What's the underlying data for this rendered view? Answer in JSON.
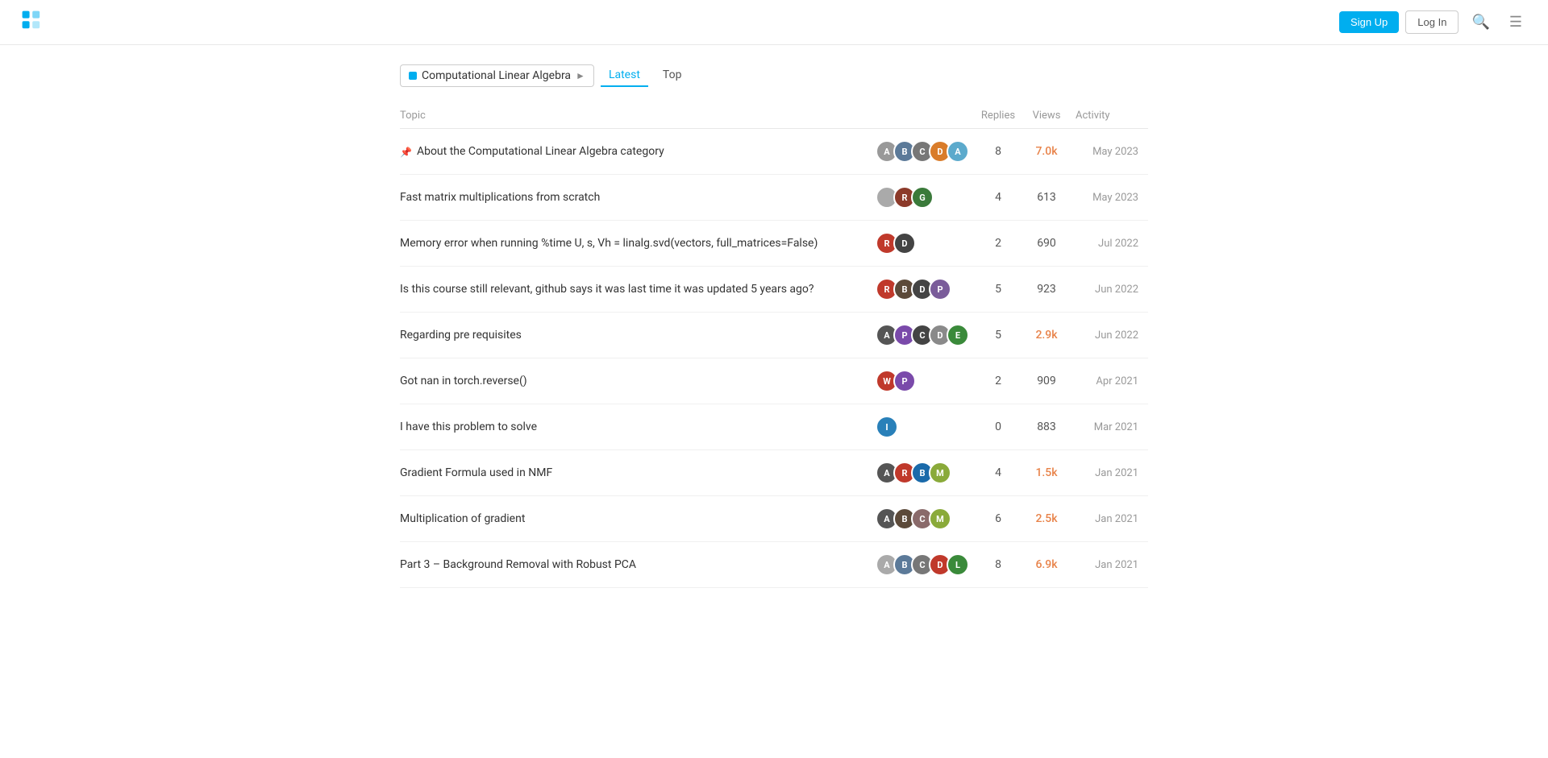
{
  "nav": {
    "signup_label": "Sign Up",
    "login_label": "Log In"
  },
  "category": {
    "label": "Computational Linear Algebra",
    "dot_color": "#00aeef"
  },
  "tabs": [
    {
      "id": "latest",
      "label": "Latest",
      "active": true
    },
    {
      "id": "top",
      "label": "Top",
      "active": false
    }
  ],
  "columns": {
    "topic": "Topic",
    "replies": "Replies",
    "views": "Views",
    "activity": "Activity"
  },
  "topics": [
    {
      "id": 1,
      "pinned": true,
      "title": "About the Computational Linear Algebra category",
      "replies": 8,
      "views": "7.0k",
      "views_highlight": true,
      "activity": "May 2023",
      "avatars": [
        {
          "color": "#999",
          "letter": "A"
        },
        {
          "color": "#5c7a99",
          "letter": "B"
        },
        {
          "color": "#777",
          "letter": "C"
        },
        {
          "color": "#d97c2a",
          "letter": "D"
        },
        {
          "color": "#5caacc",
          "letter": "A"
        }
      ]
    },
    {
      "id": 2,
      "pinned": false,
      "title": "Fast matrix multiplications from scratch",
      "replies": 4,
      "views": "613",
      "views_highlight": false,
      "activity": "May 2023",
      "avatars": [
        {
          "color": "#aaa",
          "letter": "🔵"
        },
        {
          "color": "#8c3a2a",
          "letter": "R"
        },
        {
          "color": "#3a7a3a",
          "letter": "G"
        }
      ]
    },
    {
      "id": 3,
      "pinned": false,
      "title": "Memory error when running %time U, s, Vh = linalg.svd(vectors, full_matrices=False)",
      "replies": 2,
      "views": "690",
      "views_highlight": false,
      "activity": "Jul 2022",
      "avatars": [
        {
          "color": "#c0392b",
          "letter": "R"
        },
        {
          "color": "#444",
          "letter": "D"
        }
      ]
    },
    {
      "id": 4,
      "pinned": false,
      "title": "Is this course still relevant, github says it was last time it was updated 5 years ago?",
      "replies": 5,
      "views": "923",
      "views_highlight": false,
      "activity": "Jun 2022",
      "avatars": [
        {
          "color": "#c0392b",
          "letter": "R"
        },
        {
          "color": "#5c4a3a",
          "letter": "B"
        },
        {
          "color": "#444",
          "letter": "D"
        },
        {
          "color": "#7a5c9a",
          "letter": "P"
        }
      ]
    },
    {
      "id": 5,
      "pinned": false,
      "title": "Regarding pre requisites",
      "replies": 5,
      "views": "2.9k",
      "views_highlight": true,
      "activity": "Jun 2022",
      "avatars": [
        {
          "color": "#555",
          "letter": "A"
        },
        {
          "color": "#7a4aaa",
          "letter": "P"
        },
        {
          "color": "#444",
          "letter": "C"
        },
        {
          "color": "#8a8a8a",
          "letter": "D"
        },
        {
          "color": "#3a8a3a",
          "letter": "E"
        }
      ]
    },
    {
      "id": 6,
      "pinned": false,
      "title": "Got nan in torch.reverse()",
      "replies": 2,
      "views": "909",
      "views_highlight": false,
      "activity": "Apr 2021",
      "avatars": [
        {
          "color": "#c0392b",
          "letter": "W"
        },
        {
          "color": "#7a4aaa",
          "letter": "P"
        }
      ]
    },
    {
      "id": 7,
      "pinned": false,
      "title": "I have this problem to solve",
      "replies": 0,
      "views": "883",
      "views_highlight": false,
      "activity": "Mar 2021",
      "avatars": [
        {
          "color": "#2980b9",
          "letter": "I"
        }
      ]
    },
    {
      "id": 8,
      "pinned": false,
      "title": "Gradient Formula used in NMF",
      "replies": 4,
      "views": "1.5k",
      "views_highlight": true,
      "activity": "Jan 2021",
      "avatars": [
        {
          "color": "#555",
          "letter": "A"
        },
        {
          "color": "#c0392b",
          "letter": "R"
        },
        {
          "color": "#1a6aaa",
          "letter": "B"
        },
        {
          "color": "#8aaa3a",
          "letter": "M"
        }
      ]
    },
    {
      "id": 9,
      "pinned": false,
      "title": "Multiplication of gradient",
      "replies": 6,
      "views": "2.5k",
      "views_highlight": true,
      "activity": "Jan 2021",
      "avatars": [
        {
          "color": "#555",
          "letter": "A"
        },
        {
          "color": "#5c4a3a",
          "letter": "B"
        },
        {
          "color": "#8a6a6a",
          "letter": "C"
        },
        {
          "color": "#8aaa3a",
          "letter": "M"
        }
      ]
    },
    {
      "id": 10,
      "pinned": false,
      "title": "Part 3 – Background Removal with Robust PCA",
      "replies": 8,
      "views": "6.9k",
      "views_highlight": true,
      "activity": "Jan 2021",
      "avatars": [
        {
          "color": "#aaa",
          "letter": "A"
        },
        {
          "color": "#5c7a99",
          "letter": "B"
        },
        {
          "color": "#777",
          "letter": "C"
        },
        {
          "color": "#c0392b",
          "letter": "D"
        },
        {
          "color": "#3a8a3a",
          "letter": "L"
        }
      ]
    }
  ]
}
